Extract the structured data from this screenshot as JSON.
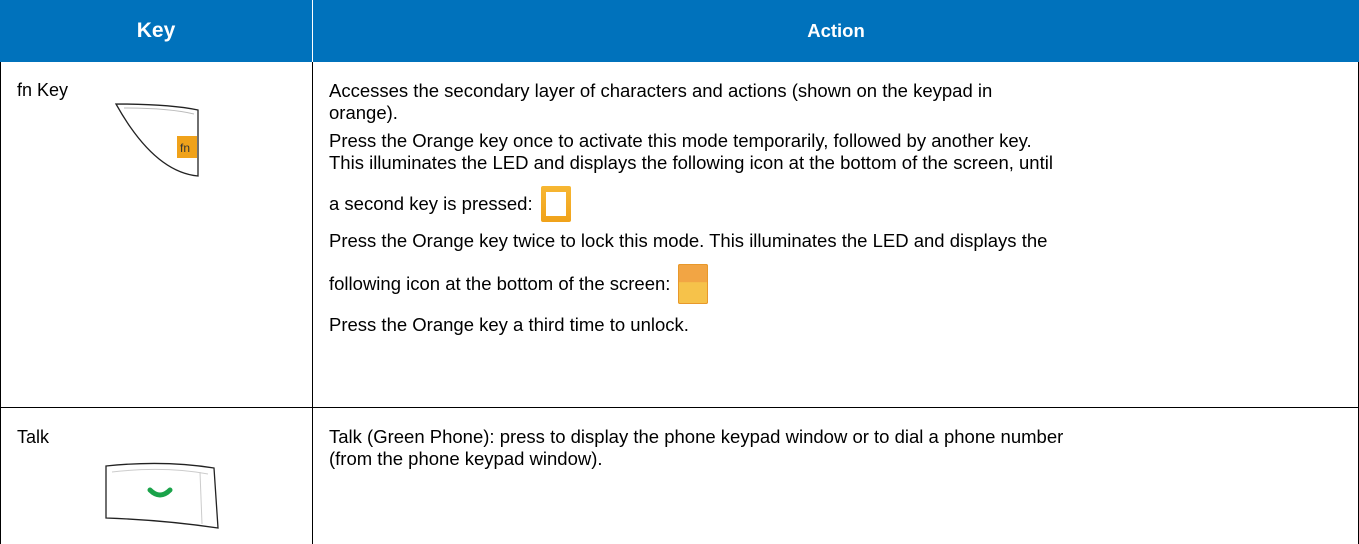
{
  "header": {
    "key": "Key",
    "action": "Action"
  },
  "rows": [
    {
      "key": "fn Key",
      "key_icon_label": "fn",
      "lines": [
        "Accesses the secondary layer of characters and actions (shown on the keypad in",
        "orange).",
        "Press the Orange key once to activate this mode temporarily, followed by another key.",
        "This illuminates the LED and displays the following icon at the bottom of the screen, until",
        "a second key is pressed:",
        "Press the Orange key twice to lock this mode. This illuminates the LED and displays the",
        "following icon at the bottom of the screen:",
        "Press the Orange key a third time to unlock."
      ]
    },
    {
      "key": "Talk",
      "lines": [
        "Talk (Green Phone): press to display the phone keypad window or to dial a phone number",
        "(from the phone keypad window)."
      ]
    }
  ],
  "colors": {
    "header_bg": "#0072bc",
    "orange": "#f0a21a",
    "green": "#1aa34a"
  }
}
